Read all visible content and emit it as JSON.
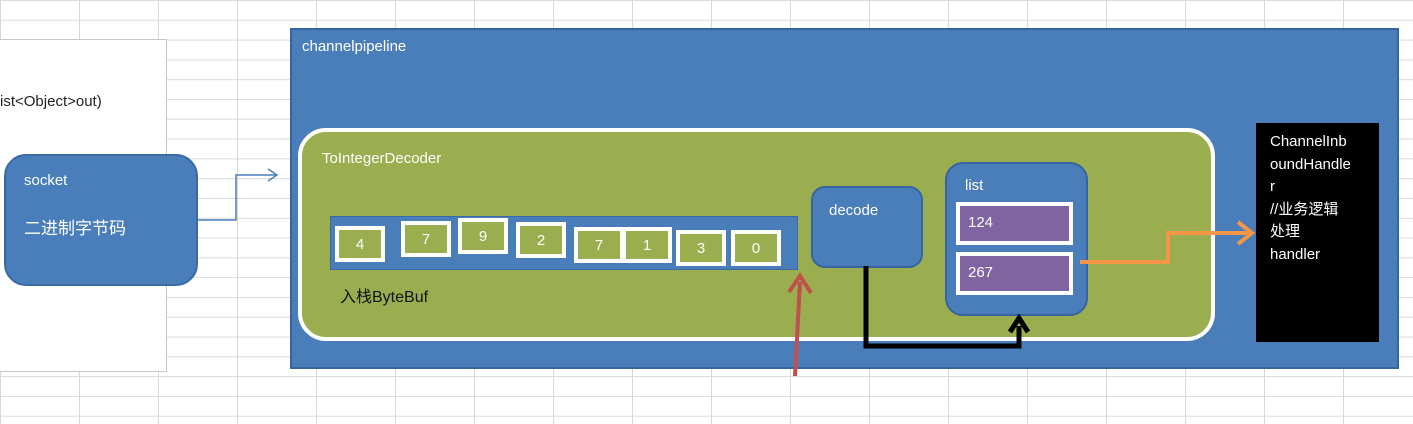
{
  "left": {
    "signature_text": "ist<Object>out)",
    "socket": {
      "title": "socket",
      "subtitle": "二进制字节码"
    }
  },
  "pipeline": {
    "label": "channelpipeline",
    "decoder": {
      "label": "ToIntegerDecoder",
      "bytebuf": {
        "cells": [
          "4",
          "7",
          "9",
          "2",
          "7",
          "1",
          "3",
          "0"
        ],
        "label": "入栈ByteBuf"
      },
      "decode": {
        "label": "decode"
      },
      "list": {
        "label": "list",
        "items": [
          "124",
          "267"
        ]
      }
    }
  },
  "handler": {
    "lines": [
      "ChannelInb",
      "oundHandle",
      "r",
      "//业务逻辑",
      "处理",
      "handler"
    ]
  },
  "colors": {
    "blue": "#4a7ebb",
    "green": "#9aae4f",
    "purple": "#8064a2",
    "orange_arrow": "#f79646",
    "red_arrow": "#c0504d",
    "black_arrow": "#000000"
  }
}
